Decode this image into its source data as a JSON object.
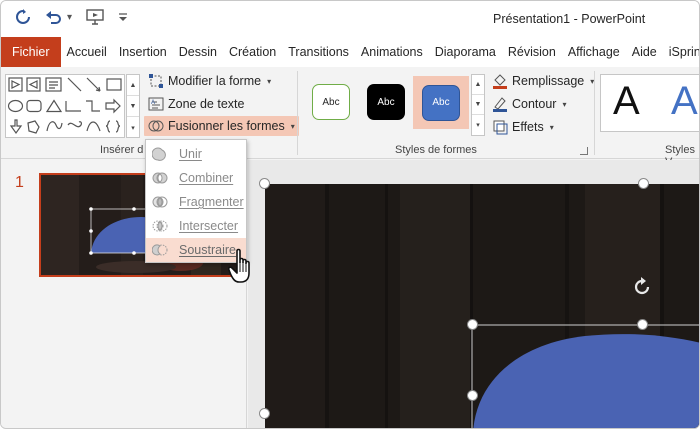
{
  "titlebar": {
    "title": "Présentation1  -  PowerPoint",
    "qat": [
      "save-icon",
      "undo-icon",
      "present-from-start-icon",
      "customize-qat-icon"
    ]
  },
  "tabs": [
    "Fichier",
    "Accueil",
    "Insertion",
    "Dessin",
    "Création",
    "Transitions",
    "Animations",
    "Diaporama",
    "Révision",
    "Affichage",
    "Aide",
    "iSpring"
  ],
  "ribbon": {
    "insert_shapes_label": "Insérer d",
    "edit_shape": "Modifier la forme",
    "text_box": "Zone de texte",
    "merge_shapes": "Fusionner les formes",
    "shape_styles_label": "Styles de formes",
    "style_samples": [
      "Abc",
      "Abc",
      "Abc"
    ],
    "fill": "Remplissage",
    "outline": "Contour",
    "effects": "Effets",
    "wordart_label": "Styles V",
    "wordart_samples": [
      "A",
      "A"
    ]
  },
  "merge_menu": {
    "items": [
      {
        "label": "Unir",
        "icon": "union-icon"
      },
      {
        "label": "Combiner",
        "icon": "combine-icon"
      },
      {
        "label": "Fragmenter",
        "icon": "fragment-icon"
      },
      {
        "label": "Intersecter",
        "icon": "intersect-icon"
      },
      {
        "label": "Soustraire",
        "icon": "subtract-icon"
      }
    ],
    "hovered": "Soustraire"
  },
  "slides_pane": {
    "slide_number": "1"
  },
  "colors": {
    "accent": "#c43e1c",
    "shape_fill": "#4a63b3",
    "hover": "#f9dcd0",
    "selected_style": "#f4c7b5"
  }
}
